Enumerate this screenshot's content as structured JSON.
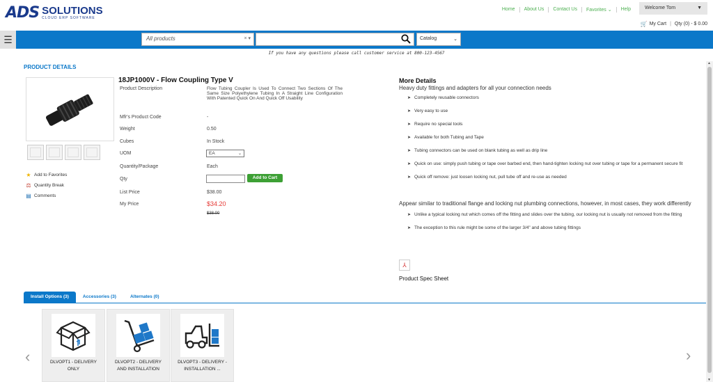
{
  "header": {
    "logo_mark": "ADS",
    "logo_name": "SOLUTIONS",
    "logo_tagline": "CLOUD ERP SOFTWARE",
    "nav": [
      "Home",
      "About Us",
      "Contact Us",
      "Favorites ⌄",
      "Help"
    ],
    "welcome": "Welcome Tom",
    "cart_label": "My Cart",
    "cart_qty": "Qty (0) - $ 0.00"
  },
  "search": {
    "product_filter": "All products",
    "search_value": "",
    "catalog": "Catalog"
  },
  "notice": "If you have any questions please call customer service at 800-123-4567",
  "product": {
    "section_title": "PRODUCT DETAILS",
    "name": "18JP1000V - Flow Coupling Type V",
    "description_label": "Product Description",
    "description": "Flow Tubing Coupler Is Used To Connect Two Sections Of The Same Size Polyethylene Tubing In A Straight Line Configuration With Patented Quick On And Quick Off Usability",
    "mfr_label": "Mfr's Product Code",
    "mfr_value": "-",
    "weight_label": "Weight",
    "weight_value": "0.50",
    "cubes_label": "Cubes",
    "cubes_value": "In Stock",
    "uom_label": "UOM",
    "uom_value": "EA",
    "qpp_label": "Quantity/Package",
    "qpp_value": "Each",
    "qty_label": "Qty",
    "add_to_cart": "Add to Cart",
    "list_price_label": "List Price",
    "list_price": "$38.00",
    "my_price_label": "My Price",
    "my_price": "$34.20",
    "old_price": "$38.00"
  },
  "side_links": {
    "favorites": "Add to Favorites",
    "quantity_break": "Quantity Break",
    "comments": "Comments"
  },
  "more_details": {
    "title": "More Details",
    "subtitle": "Heavy duty fittings and adapters for all your connection needs",
    "bullets": [
      "Completely reusable connectors",
      "Very easy to use",
      "Require no special tools",
      "Available for both Tubing and Tape",
      "Tubing connectors can be used on blank tubing as well as drip line",
      "Quick on use: simply push tubing or tape over barbed end, then hand-tighten locking nut over tubing or tape for a permanent secure fit",
      "Quick off remove: just loosen locking nut, pull tube off and re-use as needed"
    ],
    "subtitle2": "Appear similar to traditional flange and locking nut plumbing connections, however, in most cases, they work differently",
    "bullets2": [
      "Unlike a typical locking nut which comes off the fitting and slides over the tubing, our locking nut is usually not removed from the fitting",
      "The exception to this rule might be some of the larger 3/4\" and above tubing fittings"
    ],
    "spec_sheet": "Product Spec Sheet"
  },
  "tabs": [
    "Install Options (3)",
    "Accessories (3)",
    "Alternates (0)"
  ],
  "options": [
    {
      "line1": "DLVOPT1 - DELIVERY",
      "line2": "ONLY"
    },
    {
      "line1": "DLVOPT2 - DELIVERY",
      "line2": "AND INSTALLATION"
    },
    {
      "line1": "DLVOPT3 - DELIVERY -",
      "line2": "INSTALLATION ..."
    }
  ],
  "colors": {
    "brand_blue": "#0b78c9",
    "nav_green": "#4caf50",
    "price_red": "#e53935",
    "add_cart_green": "#3da035"
  }
}
